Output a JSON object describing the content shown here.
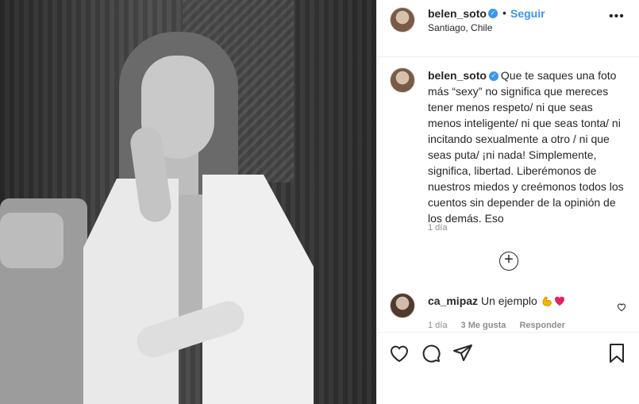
{
  "header": {
    "username": "belen_soto",
    "follow_label": "Seguir",
    "location": "Santiago, Chile",
    "more_label": "•••"
  },
  "caption": {
    "username": "belen_soto",
    "text": "Que te saques una foto más “sexy” no significa que mereces tener menos respeto/ ni que seas menos inteligente/ ni que seas tonta/ ni incitando sexualmente a otro / ni que seas puta/ ¡ni nada! Simplemente, significa, libertad. Liberémonos de nuestros miedos y creémonos todos los cuentos sin depender de la opinión de los demás. Eso",
    "time": "1 día"
  },
  "load_more_label": "+",
  "comments": [
    {
      "username": "ca_mipaz",
      "text": "Un ejemplo",
      "emojis": [
        "muscle-icon",
        "heart-icon"
      ],
      "time": "1 día",
      "likes": "3 Me gusta",
      "reply_label": "Responder"
    }
  ],
  "colors": {
    "accent": "#3897f0",
    "text": "#262626",
    "muted": "#8e8e8e",
    "border": "#efefef"
  }
}
